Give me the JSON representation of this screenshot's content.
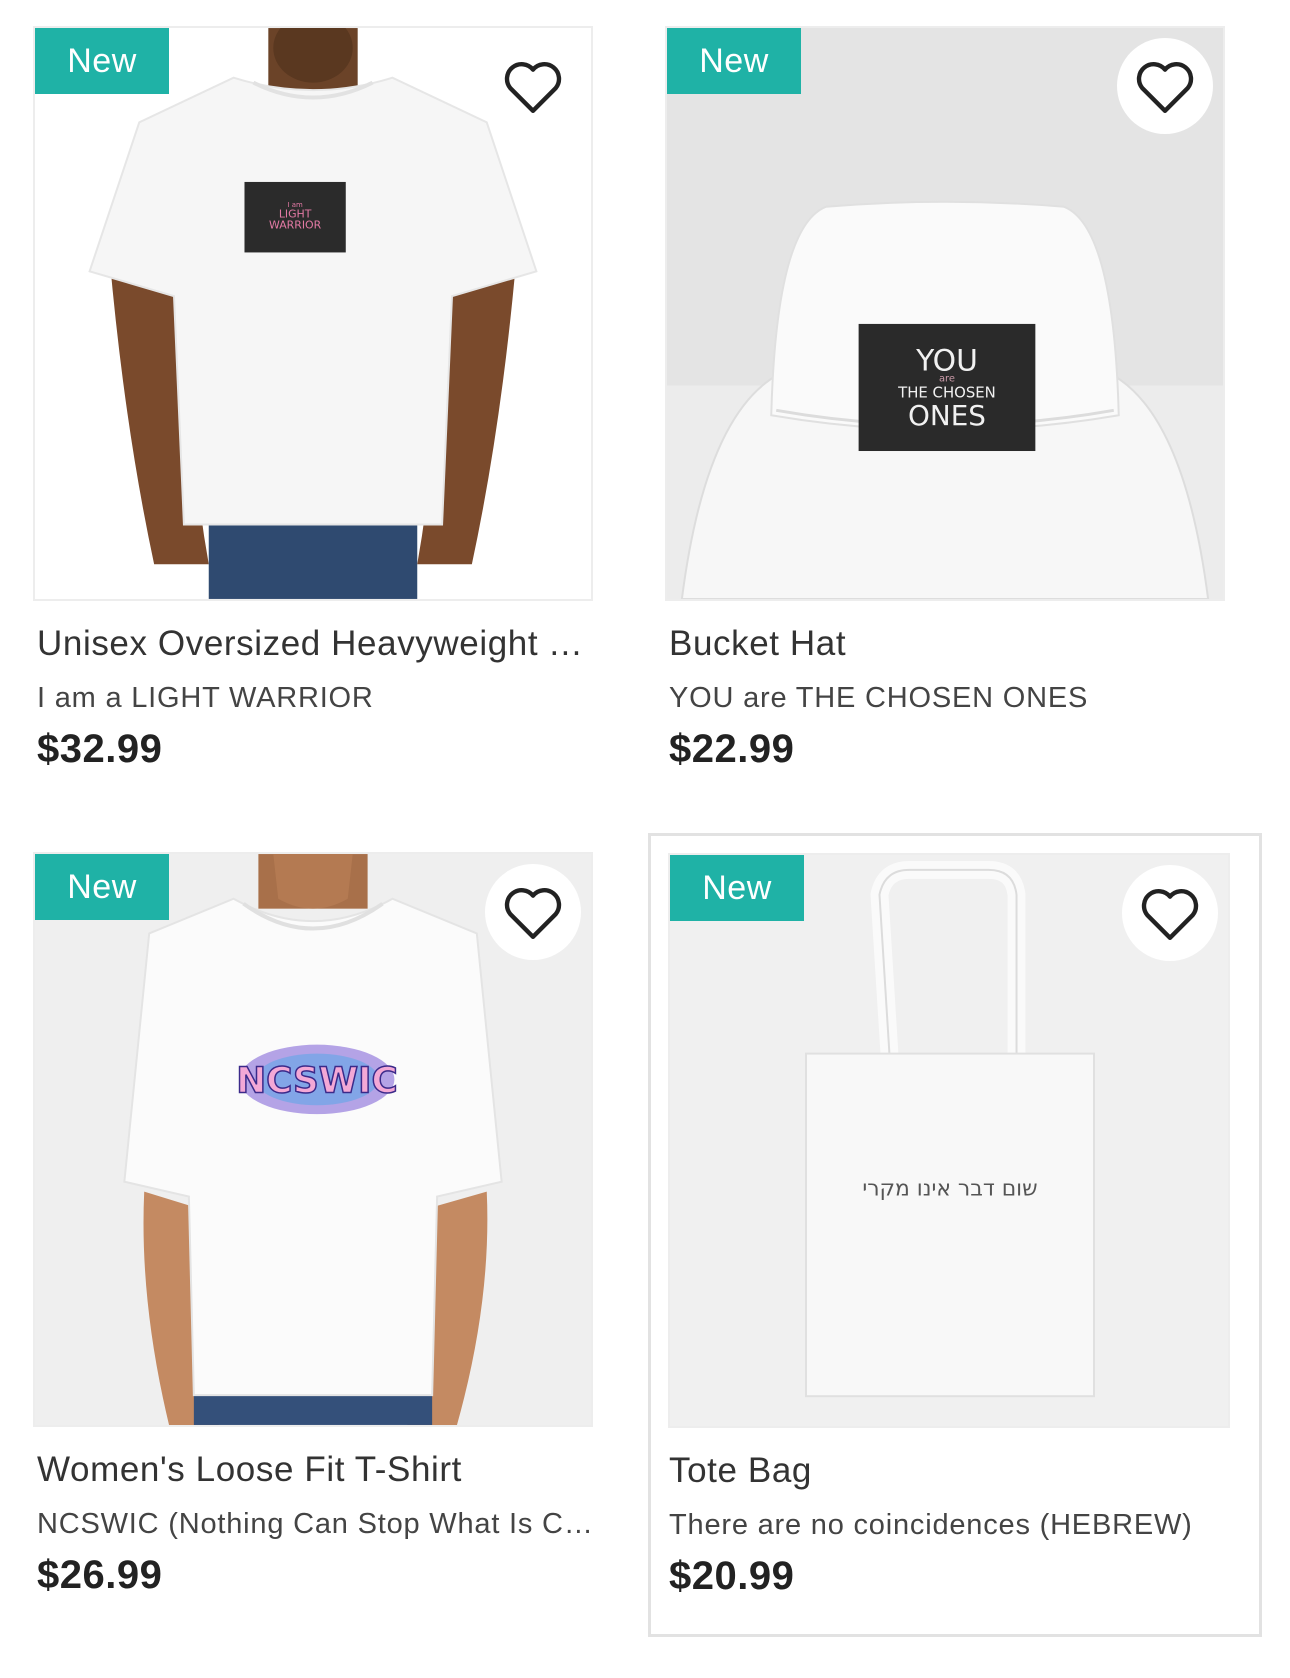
{
  "products": [
    {
      "badge": "New",
      "name": "Unisex Oversized Heavyweight T…",
      "design": "I am a LIGHT WARRIOR",
      "price": "$32.99",
      "print_small": "I am",
      "print_line1": "LIGHT",
      "print_line2": "WARRIOR"
    },
    {
      "badge": "New",
      "name": "Bucket Hat",
      "design": "YOU are THE CHOSEN ONES",
      "price": "$22.99",
      "print_line1": "YOU",
      "print_small": "are",
      "print_line2": "THE CHOSEN",
      "print_line3": "ONES"
    },
    {
      "badge": "New",
      "name": "Women's Loose Fit T-Shirt",
      "design": "NCSWIC (Nothing Can Stop What Is Co…",
      "price": "$26.99",
      "print_line1": "NCSWIC"
    },
    {
      "badge": "New",
      "name": "Tote Bag",
      "design": "There are no coincidences (HEBREW)",
      "price": "$20.99",
      "print_line1": "שום דבר אינו מקרי"
    }
  ],
  "colors": {
    "badge": "#1fb2a6",
    "price": "#222222"
  }
}
